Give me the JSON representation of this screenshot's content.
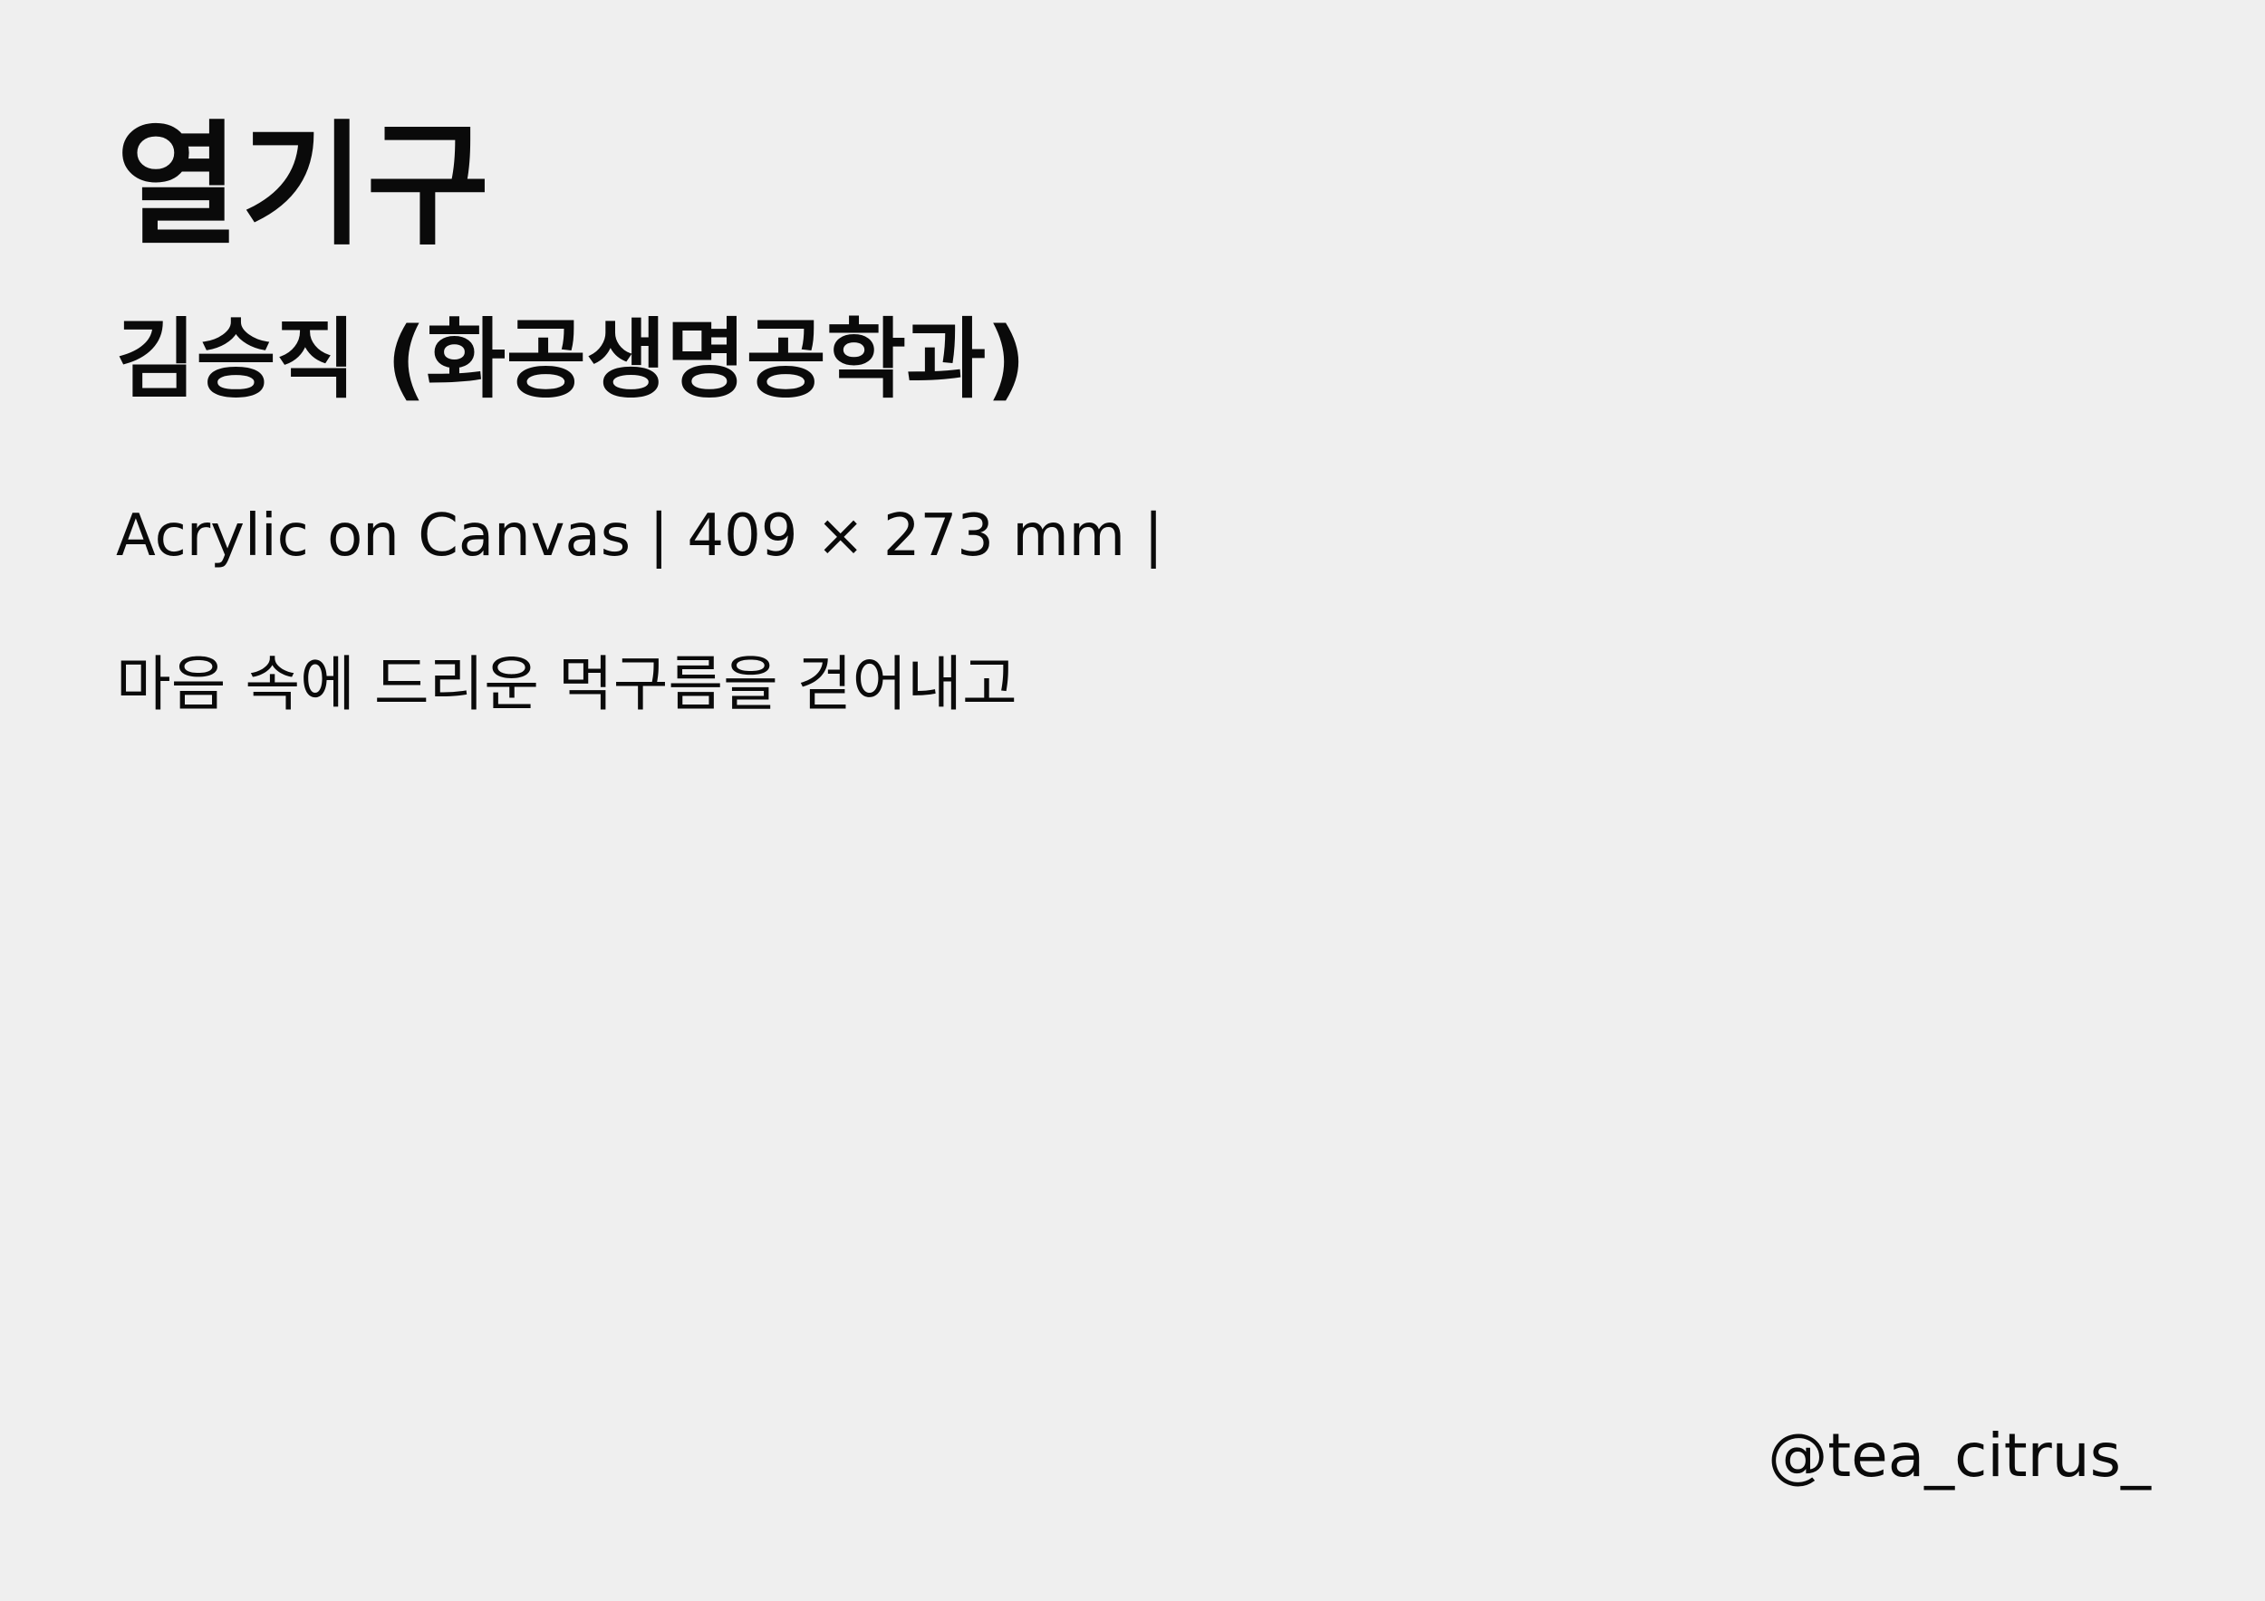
{
  "artwork": {
    "title": "열기구",
    "artist": "김승직 (화공생명공학과)",
    "details": "Acrylic on Canvas | 409 × 273 mm |",
    "description": "마음 속에 드리운 먹구름을 걷어내고"
  },
  "footer": {
    "handle": "@tea_citrus_"
  }
}
